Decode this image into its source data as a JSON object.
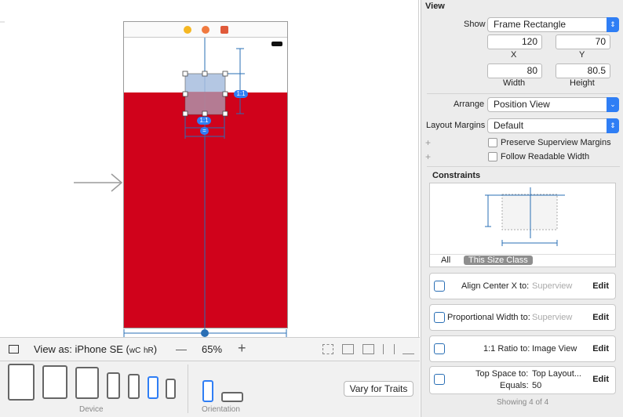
{
  "inspector": {
    "section_title": "View",
    "show_label": "Show",
    "show_value": "Frame Rectangle",
    "x_value": "120",
    "y_value": "70",
    "x_label": "X",
    "y_label": "Y",
    "width_value": "80",
    "height_value": "80.5",
    "width_label": "Width",
    "height_label": "Height",
    "arrange_label": "Arrange",
    "arrange_value": "Position View",
    "margins_label": "Layout Margins",
    "margins_value": "Default",
    "preserve_label": "Preserve Superview Margins",
    "follow_label": "Follow Readable Width",
    "constraints_title": "Constraints",
    "tab_all": "All",
    "tab_size_class": "This Size Class",
    "constraints": [
      {
        "label": "Align Center X to:",
        "target": "Superview",
        "edit": "Edit"
      },
      {
        "label": "Proportional Width to:",
        "target": "Superview",
        "edit": "Edit"
      },
      {
        "label": "1:1 Ratio to:",
        "target": "Image View",
        "edit": "Edit"
      },
      {
        "label": "Top Space to:",
        "target": "Top Layout...",
        "equals_label": "Equals:",
        "equals_value": "50",
        "edit": "Edit"
      }
    ],
    "showing": "Showing 4 of 4"
  },
  "canvas": {
    "badge_ratio": "1:1",
    "badge_ratio_2": "1:1",
    "badge_equal": "="
  },
  "bottom": {
    "view_as": "View as: iPhone SE (",
    "size_class_w": "wC",
    "size_class_h": "hR",
    "view_as_close": ")",
    "zoom_minus": "—",
    "zoom": "65%",
    "zoom_plus": "+",
    "device_label": "Device",
    "orientation_label": "Orientation",
    "vary_button": "Vary for Traits"
  },
  "colors": {
    "accent": "#2f7ef5",
    "red_view": "#d0021b",
    "selected_view": "#a8bedf"
  }
}
